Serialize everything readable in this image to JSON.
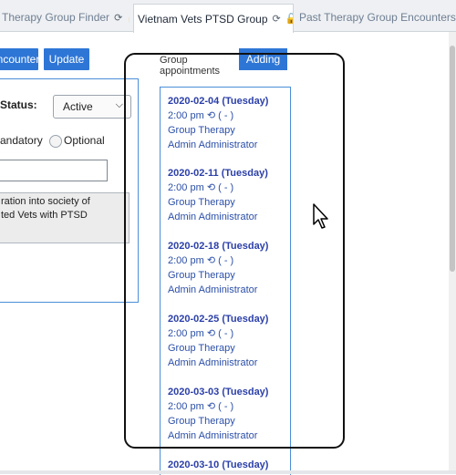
{
  "tabs": [
    {
      "label": "Therapy Group Finder",
      "active": false
    },
    {
      "label": "Vietnam Vets PTSD Group",
      "active": true
    },
    {
      "label": "Past Therapy Group Encounters",
      "active": false
    }
  ],
  "tab_controls": {
    "refresh": "⟳",
    "lock": "🔓",
    "close": "✖"
  },
  "toolbar": {
    "encounter_label": "ncounter",
    "update_label": "Update"
  },
  "form": {
    "status_label": "Status:",
    "status_value": "Active",
    "mandatory_label": "andatory",
    "optional_label": "Optional",
    "description_lines": [
      "ration into society of",
      "ted Vets with PTSD"
    ]
  },
  "appointments": {
    "header": "Group appointments",
    "adding_label": "Adding",
    "items": [
      {
        "date": "2020-02-04 (Tuesday)",
        "time": "2:00 pm",
        "range": "( - )",
        "type": "Group Therapy",
        "provider": "Admin Administrator"
      },
      {
        "date": "2020-02-11 (Tuesday)",
        "time": "2:00 pm",
        "range": "( - )",
        "type": "Group Therapy",
        "provider": "Admin Administrator"
      },
      {
        "date": "2020-02-18 (Tuesday)",
        "time": "2:00 pm",
        "range": "( - )",
        "type": "Group Therapy",
        "provider": "Admin Administrator"
      },
      {
        "date": "2020-02-25 (Tuesday)",
        "time": "2:00 pm",
        "range": "( - )",
        "type": "Group Therapy",
        "provider": "Admin Administrator"
      },
      {
        "date": "2020-03-03 (Tuesday)",
        "time": "2:00 pm",
        "range": "( - )",
        "type": "Group Therapy",
        "provider": "Admin Administrator"
      },
      {
        "date": "2020-03-10 (Tuesday)",
        "time": "",
        "range": "",
        "type": "",
        "provider": ""
      }
    ]
  },
  "colors": {
    "accent": "#2e76d6",
    "panel_border": "#4b8ed8",
    "link": "#2b4fa8"
  }
}
